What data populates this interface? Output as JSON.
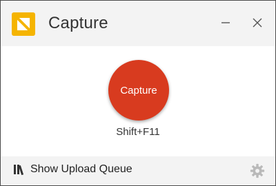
{
  "titlebar": {
    "app_icon": "capture-app-icon",
    "title": "Capture",
    "minimize_icon": "minimize-icon",
    "close_icon": "close-icon"
  },
  "main": {
    "capture_button_label": "Capture",
    "shortcut": "Shift+F11"
  },
  "footer": {
    "queue_icon": "books-icon",
    "queue_label": "Show Upload Queue",
    "settings_icon": "gear-icon"
  },
  "colors": {
    "accent": "#d83b1f",
    "app_icon_yellow": "#f5b400",
    "titlebar_bg": "#f3f3f3",
    "footer_bg": "#f3f3f3"
  }
}
